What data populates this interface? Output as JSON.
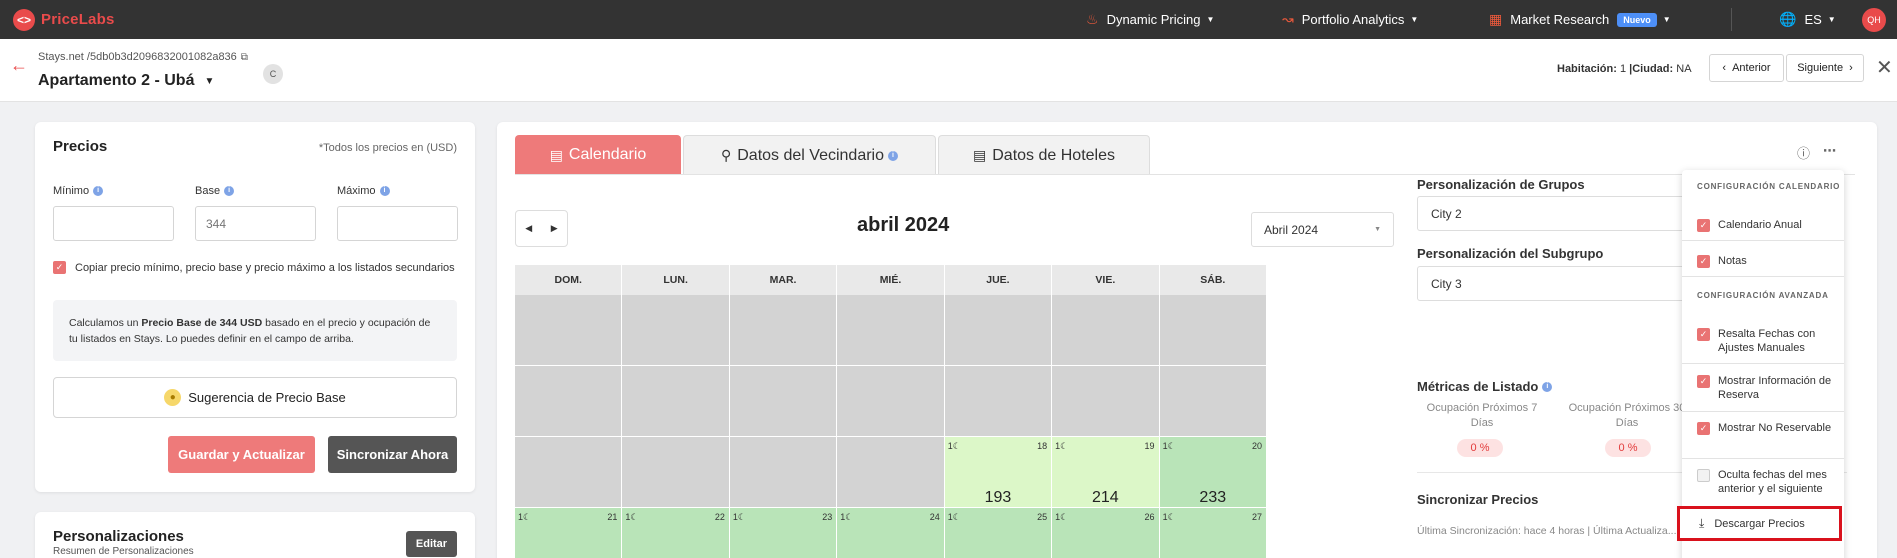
{
  "brand": {
    "name": "PriceLabs",
    "logo_glyph": "<>",
    "color": "#e94b4b"
  },
  "nav": {
    "dynamic_pricing": "Dynamic Pricing",
    "portfolio_analytics": "Portfolio Analytics",
    "market_research": "Market Research",
    "market_research_badge": "Nuevo",
    "language": "ES",
    "avatar_initials": "QH"
  },
  "subheader": {
    "breadcrumb": "Stays.net /5db0b3d2096832001082a836",
    "listing_title": "Apartamento 2 - Ubá",
    "badge": "C",
    "habitacion_label": "Habitación:",
    "habitacion_value": "1",
    "ciudad_label": "|Ciudad:",
    "ciudad_value": "NA",
    "prev_label": "Anterior",
    "next_label": "Siguiente"
  },
  "precios": {
    "title": "Precios",
    "note": "*Todos los precios en (USD)",
    "min_label": "Mínimo",
    "base_label": "Base",
    "max_label": "Máximo",
    "min_value": "",
    "base_placeholder": "344",
    "max_value": "",
    "copy_label": "Copiar precio mínimo, precio base y precio máximo a los listados secundarios",
    "calc_text_1": "Calculamos un ",
    "calc_bold": "Precio Base de 344 USD",
    "calc_text_2": " basado en el precio y ocupación de tu listados en Stays. Lo puedes definir en el campo de arriba.",
    "suggestion_button": "Sugerencia de Precio Base",
    "save_button": "Guardar y Actualizar",
    "sync_button": "Sincronizar Ahora"
  },
  "personalizaciones": {
    "title": "Personalizaciones",
    "subtitle": "Resumen de Personalizaciones",
    "edit_button": "Editar"
  },
  "tabs": [
    {
      "label": "Calendario",
      "icon": "calendar-icon"
    },
    {
      "label": "Datos del Vecindario",
      "icon": "map-pin-icon"
    },
    {
      "label": "Datos de Hoteles",
      "icon": "bed-icon"
    }
  ],
  "calendar": {
    "month_title": "abril 2024",
    "month_select": "Abril 2024",
    "weekdays": [
      "DOM.",
      "LUN.",
      "MAR.",
      "MIÉ.",
      "JUE.",
      "VIE.",
      "SÁB."
    ],
    "rows": [
      [
        {
          "t": "e"
        },
        {
          "t": "e"
        },
        {
          "t": "e"
        },
        {
          "t": "e"
        },
        {
          "t": "e"
        },
        {
          "t": "e"
        },
        {
          "t": "e"
        }
      ],
      [
        {
          "t": "e"
        },
        {
          "t": "e"
        },
        {
          "t": "e"
        },
        {
          "t": "e"
        },
        {
          "t": "e"
        },
        {
          "t": "e"
        },
        {
          "t": "e"
        }
      ],
      [
        {
          "t": "e"
        },
        {
          "t": "e"
        },
        {
          "t": "e"
        },
        {
          "t": "e"
        },
        {
          "t": "l",
          "m": "1☾",
          "d": "18",
          "p": "193"
        },
        {
          "t": "l",
          "m": "1☾",
          "d": "19",
          "p": "214"
        },
        {
          "t": "g",
          "m": "1☾",
          "d": "20",
          "p": "233"
        }
      ],
      [
        {
          "t": "g",
          "m": "1☾",
          "d": "21",
          "p": ""
        },
        {
          "t": "g",
          "m": "1☾",
          "d": "22",
          "p": ""
        },
        {
          "t": "g",
          "m": "1☾",
          "d": "23",
          "p": ""
        },
        {
          "t": "g",
          "m": "1☾",
          "d": "24",
          "p": ""
        },
        {
          "t": "g",
          "m": "1☾",
          "d": "25",
          "p": ""
        },
        {
          "t": "g",
          "m": "1☾",
          "d": "26",
          "p": ""
        },
        {
          "t": "g",
          "m": "1☾",
          "d": "27",
          "p": ""
        }
      ]
    ]
  },
  "side": {
    "grupos_label": "Personalización de Grupos",
    "grupos_value": "City 2",
    "subgrupo_label": "Personalización del Subgrupo",
    "subgrupo_value": "City 3",
    "metricas_label": "Métricas de Listado",
    "metric_1_label": "Ocupación Próximos 7 Días",
    "metric_1_value": "0 %",
    "metric_2_label": "Ocupación Próximos 30 Días",
    "metric_2_value": "0 %",
    "sync_title": "Sincronizar Precios",
    "sync_note": "Última Sincronización: hace 4 horas | Última Actualiza..."
  },
  "dropdown": {
    "section_1": "CONFIGURACIÓN CALENDARIO",
    "item_1": "Calendario Anual",
    "item_2": "Notas",
    "section_2": "CONFIGURACIÓN AVANZADA",
    "item_3": "Resalta Fechas con Ajustes Manuales",
    "item_4": "Mostrar Información de Reserva",
    "item_5": "Mostrar No Reservable",
    "item_6": "Oculta fechas del mes anterior y el siguiente",
    "download": "Descargar Precios"
  },
  "colors": {
    "accent": "#ee7a7a",
    "dark_button": "#555555",
    "calendar_light": "#dcf7c8",
    "calendar_green": "#b9e4b8",
    "highlight_border": "#d9111c"
  }
}
